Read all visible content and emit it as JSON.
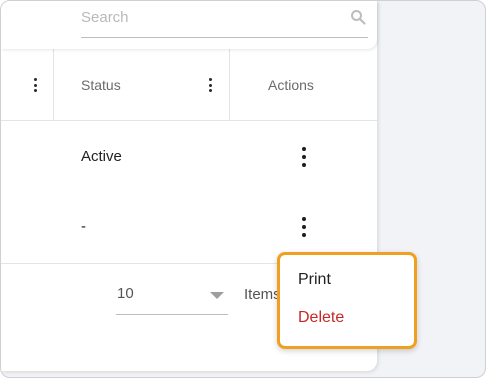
{
  "search": {
    "placeholder": "Search"
  },
  "table": {
    "columns": [
      {
        "label": "Status"
      },
      {
        "label": "Actions"
      }
    ],
    "rows": [
      {
        "status": "Active"
      },
      {
        "status": "-"
      }
    ]
  },
  "pager": {
    "page_size": "10",
    "items_label": "Items per page"
  },
  "context_menu": {
    "items": [
      {
        "label": "Print"
      },
      {
        "label": "Delete"
      }
    ]
  },
  "colors": {
    "delete": "#c62828",
    "menu_border": "#f0a020",
    "background": "#f2f3f7"
  },
  "icons": {
    "search": "magnifier",
    "column_menu": "vertical-ellipsis",
    "row_actions": "vertical-ellipsis",
    "dropdown": "caret-down"
  }
}
